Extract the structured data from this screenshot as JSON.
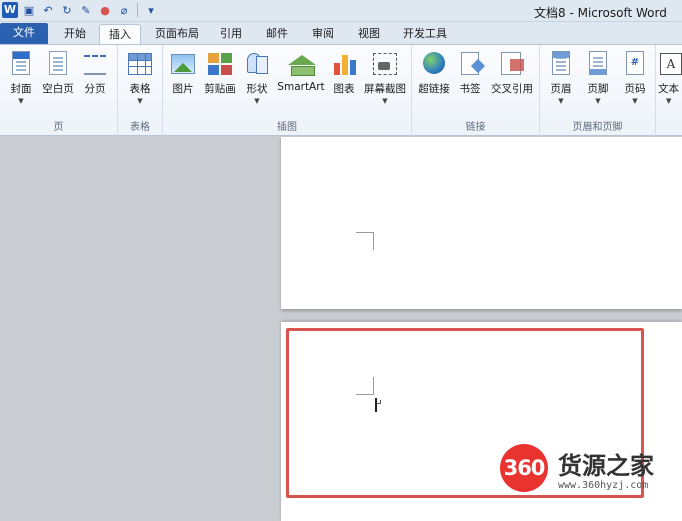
{
  "window": {
    "title": "文档8 - Microsoft Word"
  },
  "qat": {
    "app_icon": "W",
    "icons": [
      "word-logo-icon",
      "save-icon",
      "undo-icon",
      "redo-icon",
      "format-painter-icon",
      "color-icon",
      "clear-format-icon",
      "customize-icon"
    ]
  },
  "tabs": [
    {
      "label": "文件"
    },
    {
      "label": "开始"
    },
    {
      "label": "插入"
    },
    {
      "label": "页面布局"
    },
    {
      "label": "引用"
    },
    {
      "label": "邮件"
    },
    {
      "label": "审阅"
    },
    {
      "label": "视图"
    },
    {
      "label": "开发工具"
    }
  ],
  "active_tab": "插入",
  "ribbon": {
    "groups": {
      "pages": {
        "label": "页",
        "buttons": [
          "封面",
          "空白页",
          "分页"
        ]
      },
      "tables": {
        "label": "表格",
        "buttons": [
          "表格"
        ]
      },
      "illustrations": {
        "label": "插图",
        "buttons": [
          "图片",
          "剪贴画",
          "形状",
          "SmartArt",
          "图表",
          "屏幕截图"
        ]
      },
      "links": {
        "label": "链接",
        "buttons": [
          "超链接",
          "书签",
          "交叉引用"
        ]
      },
      "header_footer": {
        "label": "页眉和页脚",
        "buttons": [
          "页眉",
          "页脚",
          "页码"
        ]
      },
      "text": {
        "buttons": [
          "文本"
        ]
      }
    },
    "page_number_glyph": "#",
    "textbox_glyph": "A"
  },
  "colors": {
    "file_tab": "#2b5faf",
    "highlight": "#d9534f",
    "watermark_badge": "#e8332f"
  },
  "watermark": {
    "badge": "360",
    "title": "货源之家",
    "url": "www.360hyzj.com"
  }
}
